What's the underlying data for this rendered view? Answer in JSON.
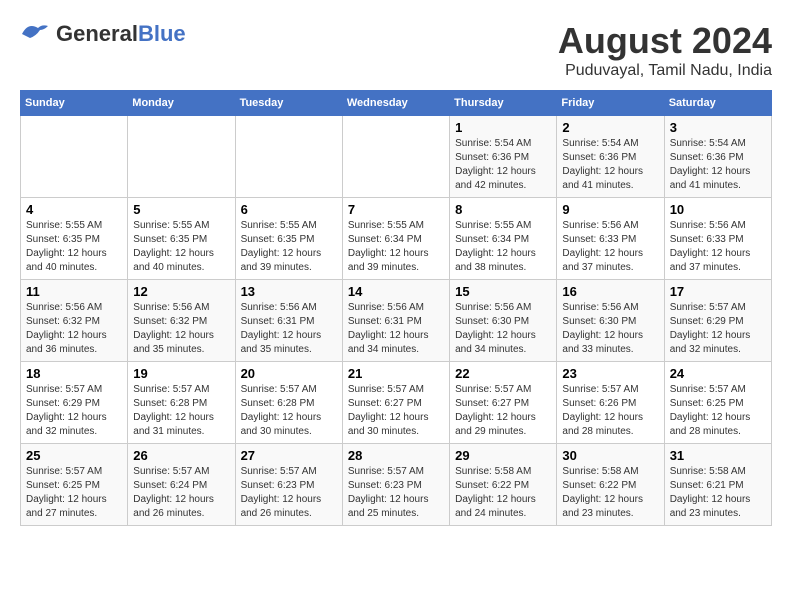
{
  "header": {
    "logo_general": "General",
    "logo_blue": "Blue",
    "title": "August 2024",
    "subtitle": "Puduvayal, Tamil Nadu, India"
  },
  "calendar": {
    "days_of_week": [
      "Sunday",
      "Monday",
      "Tuesday",
      "Wednesday",
      "Thursday",
      "Friday",
      "Saturday"
    ],
    "weeks": [
      [
        {
          "day": "",
          "info": ""
        },
        {
          "day": "",
          "info": ""
        },
        {
          "day": "",
          "info": ""
        },
        {
          "day": "",
          "info": ""
        },
        {
          "day": "1",
          "info": "Sunrise: 5:54 AM\nSunset: 6:36 PM\nDaylight: 12 hours\nand 42 minutes."
        },
        {
          "day": "2",
          "info": "Sunrise: 5:54 AM\nSunset: 6:36 PM\nDaylight: 12 hours\nand 41 minutes."
        },
        {
          "day": "3",
          "info": "Sunrise: 5:54 AM\nSunset: 6:36 PM\nDaylight: 12 hours\nand 41 minutes."
        }
      ],
      [
        {
          "day": "4",
          "info": "Sunrise: 5:55 AM\nSunset: 6:35 PM\nDaylight: 12 hours\nand 40 minutes."
        },
        {
          "day": "5",
          "info": "Sunrise: 5:55 AM\nSunset: 6:35 PM\nDaylight: 12 hours\nand 40 minutes."
        },
        {
          "day": "6",
          "info": "Sunrise: 5:55 AM\nSunset: 6:35 PM\nDaylight: 12 hours\nand 39 minutes."
        },
        {
          "day": "7",
          "info": "Sunrise: 5:55 AM\nSunset: 6:34 PM\nDaylight: 12 hours\nand 39 minutes."
        },
        {
          "day": "8",
          "info": "Sunrise: 5:55 AM\nSunset: 6:34 PM\nDaylight: 12 hours\nand 38 minutes."
        },
        {
          "day": "9",
          "info": "Sunrise: 5:56 AM\nSunset: 6:33 PM\nDaylight: 12 hours\nand 37 minutes."
        },
        {
          "day": "10",
          "info": "Sunrise: 5:56 AM\nSunset: 6:33 PM\nDaylight: 12 hours\nand 37 minutes."
        }
      ],
      [
        {
          "day": "11",
          "info": "Sunrise: 5:56 AM\nSunset: 6:32 PM\nDaylight: 12 hours\nand 36 minutes."
        },
        {
          "day": "12",
          "info": "Sunrise: 5:56 AM\nSunset: 6:32 PM\nDaylight: 12 hours\nand 35 minutes."
        },
        {
          "day": "13",
          "info": "Sunrise: 5:56 AM\nSunset: 6:31 PM\nDaylight: 12 hours\nand 35 minutes."
        },
        {
          "day": "14",
          "info": "Sunrise: 5:56 AM\nSunset: 6:31 PM\nDaylight: 12 hours\nand 34 minutes."
        },
        {
          "day": "15",
          "info": "Sunrise: 5:56 AM\nSunset: 6:30 PM\nDaylight: 12 hours\nand 34 minutes."
        },
        {
          "day": "16",
          "info": "Sunrise: 5:56 AM\nSunset: 6:30 PM\nDaylight: 12 hours\nand 33 minutes."
        },
        {
          "day": "17",
          "info": "Sunrise: 5:57 AM\nSunset: 6:29 PM\nDaylight: 12 hours\nand 32 minutes."
        }
      ],
      [
        {
          "day": "18",
          "info": "Sunrise: 5:57 AM\nSunset: 6:29 PM\nDaylight: 12 hours\nand 32 minutes."
        },
        {
          "day": "19",
          "info": "Sunrise: 5:57 AM\nSunset: 6:28 PM\nDaylight: 12 hours\nand 31 minutes."
        },
        {
          "day": "20",
          "info": "Sunrise: 5:57 AM\nSunset: 6:28 PM\nDaylight: 12 hours\nand 30 minutes."
        },
        {
          "day": "21",
          "info": "Sunrise: 5:57 AM\nSunset: 6:27 PM\nDaylight: 12 hours\nand 30 minutes."
        },
        {
          "day": "22",
          "info": "Sunrise: 5:57 AM\nSunset: 6:27 PM\nDaylight: 12 hours\nand 29 minutes."
        },
        {
          "day": "23",
          "info": "Sunrise: 5:57 AM\nSunset: 6:26 PM\nDaylight: 12 hours\nand 28 minutes."
        },
        {
          "day": "24",
          "info": "Sunrise: 5:57 AM\nSunset: 6:25 PM\nDaylight: 12 hours\nand 28 minutes."
        }
      ],
      [
        {
          "day": "25",
          "info": "Sunrise: 5:57 AM\nSunset: 6:25 PM\nDaylight: 12 hours\nand 27 minutes."
        },
        {
          "day": "26",
          "info": "Sunrise: 5:57 AM\nSunset: 6:24 PM\nDaylight: 12 hours\nand 26 minutes."
        },
        {
          "day": "27",
          "info": "Sunrise: 5:57 AM\nSunset: 6:23 PM\nDaylight: 12 hours\nand 26 minutes."
        },
        {
          "day": "28",
          "info": "Sunrise: 5:57 AM\nSunset: 6:23 PM\nDaylight: 12 hours\nand 25 minutes."
        },
        {
          "day": "29",
          "info": "Sunrise: 5:58 AM\nSunset: 6:22 PM\nDaylight: 12 hours\nand 24 minutes."
        },
        {
          "day": "30",
          "info": "Sunrise: 5:58 AM\nSunset: 6:22 PM\nDaylight: 12 hours\nand 23 minutes."
        },
        {
          "day": "31",
          "info": "Sunrise: 5:58 AM\nSunset: 6:21 PM\nDaylight: 12 hours\nand 23 minutes."
        }
      ]
    ]
  }
}
